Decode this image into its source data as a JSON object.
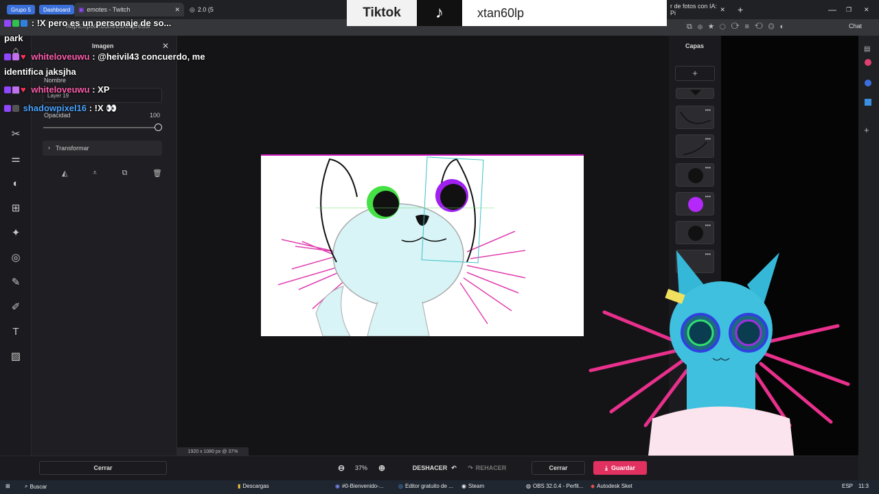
{
  "browser": {
    "group_label": "Grupo 5",
    "tabs": [
      {
        "label": "Dashboard"
      },
      {
        "label": "emotes - Twitch"
      },
      {
        "label": "2.0 (5"
      },
      {
        "label": "r de fotos con IA: Pi"
      }
    ],
    "url": "https://pixlr.com/es/express/"
  },
  "overlay": {
    "platform": "Tiktok",
    "username": "xtan60lp"
  },
  "chat": [
    {
      "user": "",
      "message": ": !X pero es un personaje de so..."
    },
    {
      "user": "",
      "message": "park"
    },
    {
      "user": "whiteloveuwu",
      "message": ": @heivil43 concuerdo, me"
    },
    {
      "user": "",
      "message": "identifica jaksjha"
    },
    {
      "user": "whiteloveuwu",
      "message": ": XP"
    },
    {
      "user": "shadowpixel16",
      "message": ": !X 👀"
    }
  ],
  "left_panel": {
    "title": "Imagen",
    "name_label": "Nombre",
    "name_value": "Layer 19",
    "opacity_label": "Opacidad",
    "opacity_value": "100",
    "transform_label": "Transformar",
    "close_label": "Cerrar"
  },
  "canvas": {
    "size_info": "1920 x 1080 px @ 37%"
  },
  "layers_panel": {
    "title": "Capas",
    "add_symbol": "+",
    "layer_colors": [
      "#111111",
      "#111111",
      "#111111",
      "#111111",
      "#b429f9",
      "#111111",
      "#111111"
    ]
  },
  "bottom_bar": {
    "zoom": "37%",
    "undo_label": "DESHACER",
    "redo_label": "REHACER",
    "close_label": "Cerrar",
    "save_label": "Guardar"
  },
  "taskbar": {
    "search_label": "Buscar",
    "items": [
      {
        "label": "Descargas"
      },
      {
        "label": "#0-Bienvenido-..."
      },
      {
        "label": "Editor gratuito de ..."
      },
      {
        "label": "Steam"
      },
      {
        "label": "OBS 32.0.4 - Perfil..."
      },
      {
        "label": "Autodesk Sket"
      }
    ],
    "lang": "ESP",
    "time": "11:3"
  },
  "sidebar": {
    "chat_label": "Chat"
  },
  "colors": {
    "accent_save": "#e03160",
    "canvas_border": "#d020c0",
    "chat_user_pink": "#ff5fae",
    "chat_user_blue": "#4da3ff"
  }
}
